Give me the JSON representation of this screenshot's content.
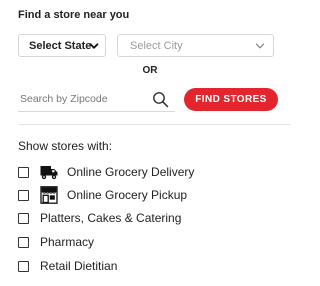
{
  "locator": {
    "title": "Find a store near you",
    "state_select": {
      "value": "Select State",
      "icon": "chevron-down-icon"
    },
    "city_select": {
      "value": "Select City",
      "icon": "chevron-down-icon"
    },
    "or_label": "OR",
    "zipcode": {
      "placeholder": "Search by Zipcode",
      "value": "",
      "icon": "search-icon"
    },
    "find_button": "FIND STORES"
  },
  "filters": {
    "title": "Show stores with:",
    "options": [
      {
        "label": "Online Grocery Delivery",
        "checked": false,
        "icon": "delivery-truck-icon"
      },
      {
        "label": "Online Grocery Pickup",
        "checked": false,
        "icon": "store-pickup-icon"
      },
      {
        "label": "Platters, Cakes & Catering",
        "checked": false
      },
      {
        "label": "Pharmacy",
        "checked": false
      },
      {
        "label": "Retail Dietitian",
        "checked": false
      }
    ]
  },
  "colors": {
    "accent": "#e4252d",
    "text": "#222222",
    "muted": "#9b9b9b",
    "border": "#d6d6d6"
  }
}
